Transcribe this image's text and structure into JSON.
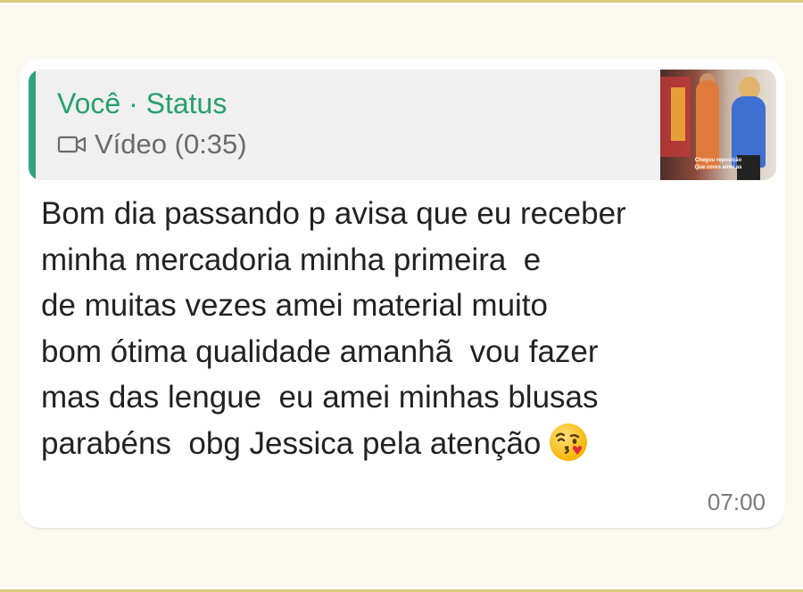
{
  "quote": {
    "author": "Você · Status",
    "media_icon": "video-camera-icon",
    "media_label": "Vídeo (0:35)",
    "thumbnail_caption_1": "Chegou reposição",
    "thumbnail_caption_2": "Que cores amei as"
  },
  "message": {
    "lines": [
      "Bom dia passando p avisa que eu receber",
      "minha mercadoria minha primeira  e",
      "de muitas vezes amei material muito",
      "bom ótima qualidade amanhã  vou fazer",
      "mas das lengue  eu amei minhas blusas",
      "parabéns  obg Jessica pela atenção"
    ],
    "emoji": "kiss-face-emoji",
    "time": "07:00"
  },
  "colors": {
    "accent_green": "#2fa47e",
    "background": "#fbfaf1",
    "bubble": "#ffffff",
    "quote_bg": "#f0f0f0"
  }
}
